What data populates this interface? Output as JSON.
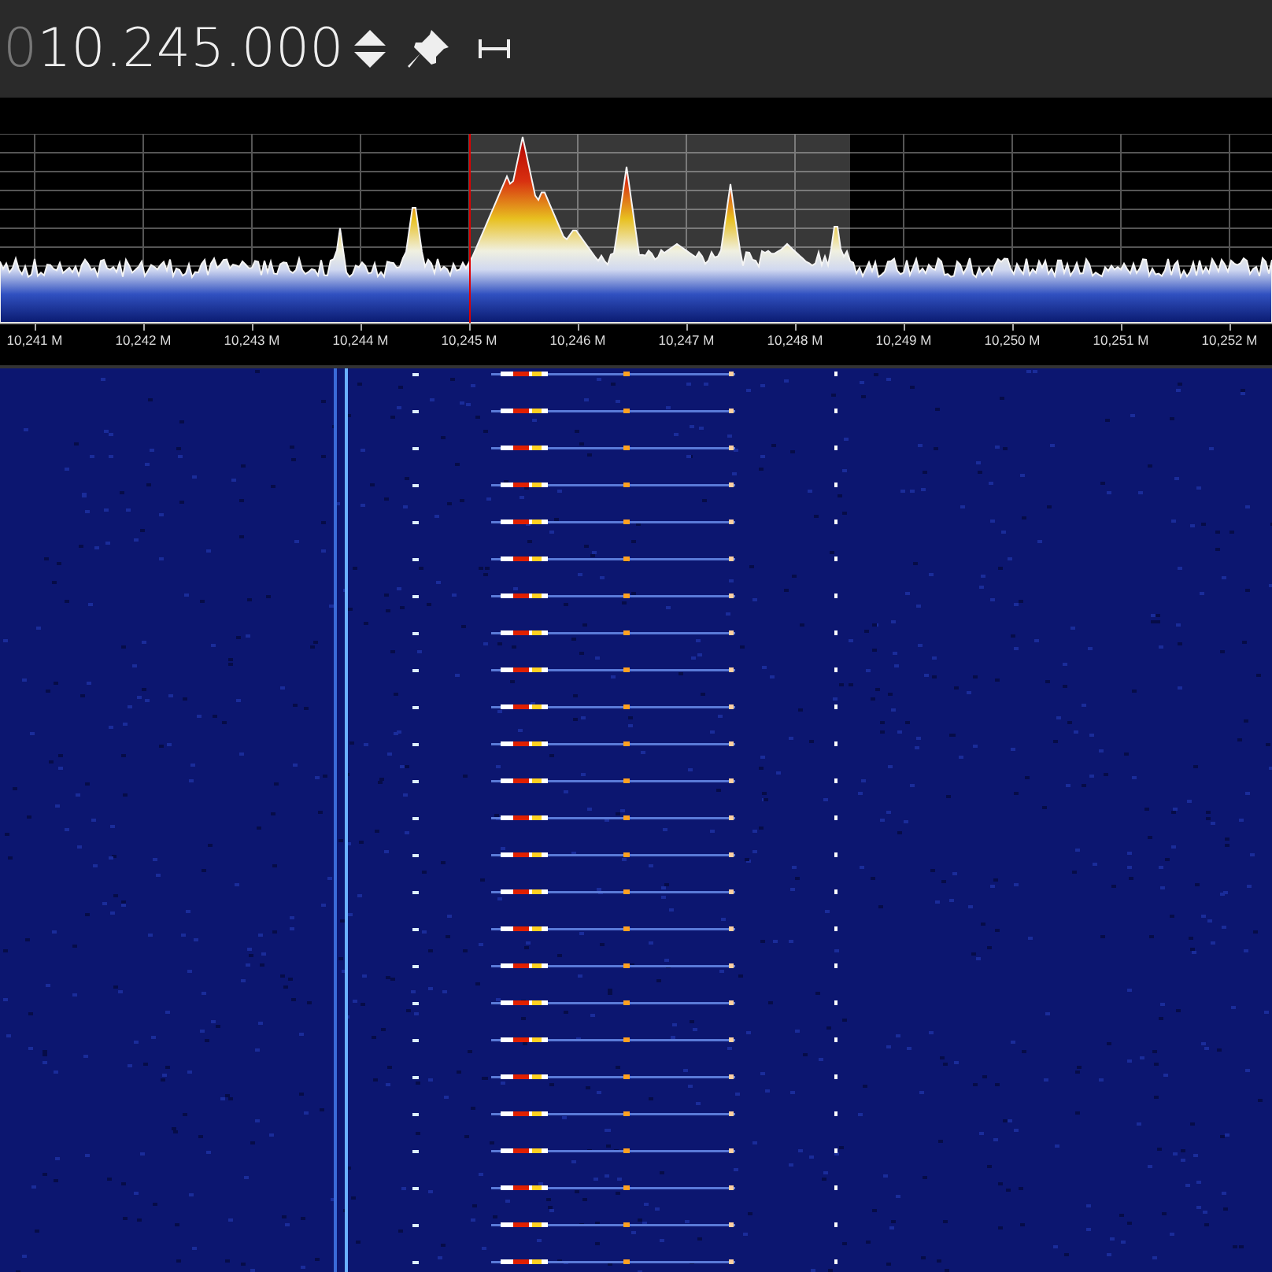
{
  "frequency": {
    "lead_digit": "0",
    "digits": "10.245.000"
  },
  "axis_labels": [
    "10,241 M",
    "10,242 M",
    "10,243 M",
    "10,244 M",
    "10,245 M",
    "10,246 M",
    "10,247 M",
    "10,248 M",
    "10,249 M",
    "10,250 M",
    "10,251 M",
    "10,252 M"
  ]
}
